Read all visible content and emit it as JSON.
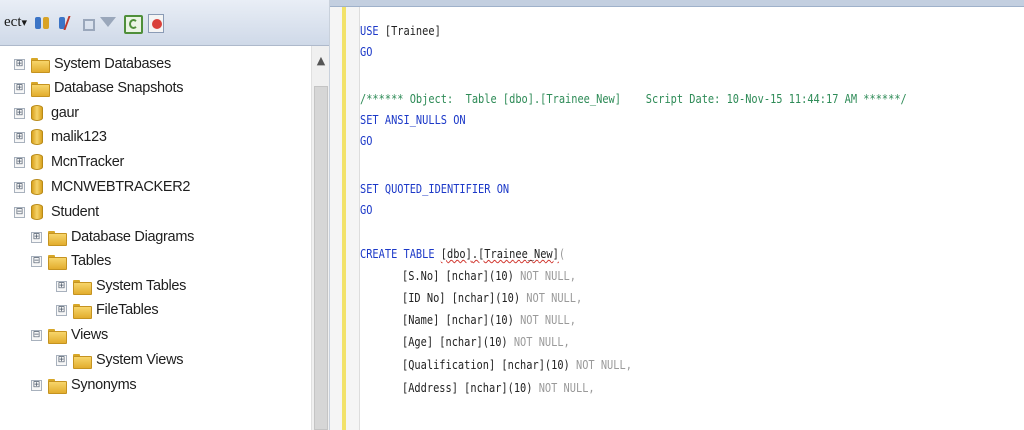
{
  "toolbar": {
    "connect_label": "ect",
    "dropdown_glyph": "▾"
  },
  "tree": {
    "nodes": [
      {
        "label": "System Databases",
        "expander": "⊞",
        "icon": "folder-icon"
      },
      {
        "label": "Database Snapshots",
        "expander": "⊞",
        "icon": "folder-icon"
      },
      {
        "label": "gaur",
        "expander": "⊞",
        "icon": "database-icon"
      },
      {
        "label": "malik123",
        "expander": "⊞",
        "icon": "database-icon"
      },
      {
        "label": "McnTracker",
        "expander": "⊞",
        "icon": "database-icon"
      },
      {
        "label": "MCNWEBTRACKER2",
        "expander": "⊞",
        "icon": "database-icon"
      },
      {
        "label": "Student",
        "expander": "⊟",
        "icon": "database-icon"
      },
      {
        "label": "Database Diagrams",
        "expander": "⊞",
        "icon": "folder-icon"
      },
      {
        "label": "Tables",
        "expander": "⊟",
        "icon": "folder-icon"
      },
      {
        "label": "System Tables",
        "expander": "⊞",
        "icon": "folder-icon"
      },
      {
        "label": "FileTables",
        "expander": "⊞",
        "icon": "folder-icon"
      },
      {
        "label": "Views",
        "expander": "⊟",
        "icon": "folder-icon"
      },
      {
        "label": "System Views",
        "expander": "⊞",
        "icon": "folder-icon"
      },
      {
        "label": "Synonyms",
        "expander": "⊞",
        "icon": "folder-icon"
      }
    ]
  },
  "editor": {
    "lines": {
      "use_kw": "USE",
      "use_target": " [Trainee]",
      "go": "GO",
      "comment": "/****** Object:  Table [dbo].[Trainee_New]    Script Date: 10-Nov-15 11:44:17 AM ******/",
      "set_kw": "SET",
      "ansi_opt": " ANSI_NULLS",
      "on_kw": " ON",
      "quoted_opt": " QUOTED_IDENTIFIER",
      "create_kw": "CREATE TABLE",
      "create_schema": "[dbo]",
      "create_dot": ".",
      "create_table": "[Trainee_New]",
      "create_paren": "(",
      "columns": [
        {
          "name": "[S.No]",
          "type": " [nchar]",
          "size": "(10)",
          "null": " NOT NULL",
          "end": ","
        },
        {
          "name": "[ID No]",
          "type": " [nchar]",
          "size": "(10)",
          "null": " NOT NULL",
          "end": ","
        },
        {
          "name": "[Name]",
          "type": " [nchar]",
          "size": "(10)",
          "null": " NOT NULL",
          "end": ","
        },
        {
          "name": "[Age]",
          "type": " [nchar]",
          "size": "(10)",
          "null": " NOT NULL",
          "end": ","
        },
        {
          "name": "[Qualification]",
          "type": " [nchar]",
          "size": "(10)",
          "null": " NOT NULL",
          "end": ","
        },
        {
          "name": "[Address]",
          "type": " [nchar]",
          "size": "(10)",
          "null": " NOT NULL",
          "end": ","
        }
      ]
    },
    "colors": {
      "keyword": "#1c39c8",
      "gray": "#9a9a9a",
      "comment": "#2e8b57"
    }
  }
}
